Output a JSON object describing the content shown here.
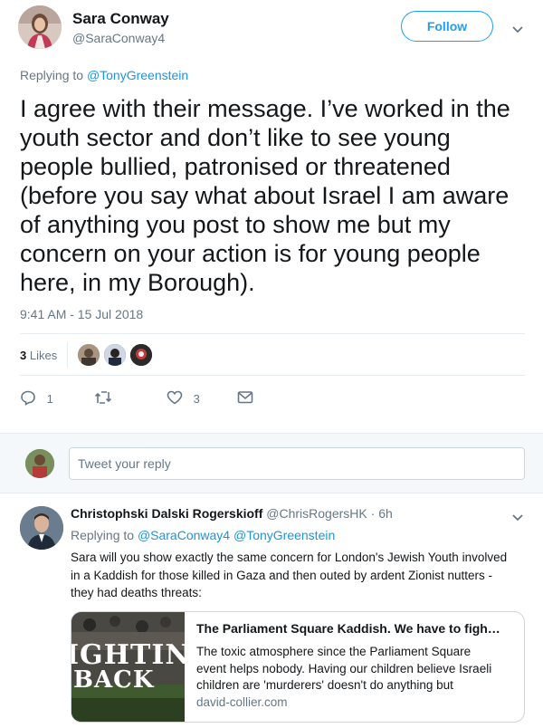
{
  "main_tweet": {
    "author_name": "Sara Conway",
    "author_handle": "@SaraConway4",
    "follow_label": "Follow",
    "replying_prefix": "Replying to",
    "replying_to": "@TonyGreenstein",
    "text_lines": [
      "I agree with their message. I’ve worked in the",
      "youth sector and don’t like to see young",
      "people bullied, patronised or threatened",
      "(before you say what about Israel I am aware",
      "of anything you post to show me but my",
      "concern on your action is for young people",
      "here, in my Borough)."
    ],
    "timestamp": "9:41 AM - 15 Jul 2018",
    "likes_count": "3",
    "likes_label": "Likes",
    "actions": {
      "reply_count": "1",
      "retweet_count": "",
      "like_count": "3"
    }
  },
  "reply_box": {
    "placeholder": "Tweet your reply"
  },
  "reply_tweet": {
    "author_name": "Christophski Dalski Rogerskioff",
    "author_handle": "@ChrisRogersHK",
    "time": "· 6h",
    "replying_prefix": "Replying to",
    "replying_to": [
      "@SaraConway4",
      "@TonyGreenstein"
    ],
    "text_lines": [
      "Sara will you show exactly the same concern for London's Jewish Youth involved",
      "in a Kaddish for those killed in Gaza and then outed by ardent Zionist nutters -",
      "they had deaths threats:"
    ],
    "card": {
      "image_text_top": "IGHTIN",
      "image_text_bottom": "BACK",
      "title": "The Parliament Square Kaddish. We have to figh…",
      "description_lines": [
        "The toxic atmosphere since the Parliament Square",
        "event helps nobody. Having our children believe Israeli",
        "children are 'murderers' doesn't do anything but"
      ],
      "domain": "david-collier.com"
    }
  },
  "colors": {
    "accent": "#1da1f2",
    "link": "#1b95e0",
    "muted": "#657786",
    "border": "#e6ecf0"
  }
}
